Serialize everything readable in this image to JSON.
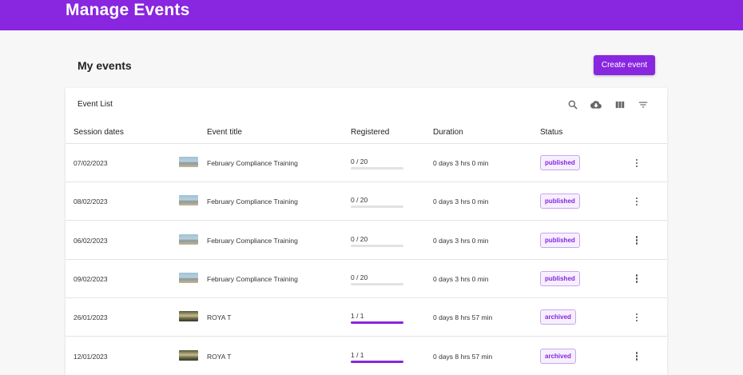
{
  "header": {
    "title": "Manage Events"
  },
  "page": {
    "section_title": "My events",
    "create_label": "Create event"
  },
  "card": {
    "title": "Event List",
    "toolbar": [
      {
        "name": "search-icon"
      },
      {
        "name": "cloud-download-icon"
      },
      {
        "name": "columns-icon"
      },
      {
        "name": "filter-icon"
      }
    ]
  },
  "table": {
    "columns": [
      "Session dates",
      "Event title",
      "Registered",
      "Duration",
      "Status"
    ],
    "rows": [
      {
        "date": "07/02/2023",
        "thumb": "a",
        "title": "February Compliance Training",
        "registered": "0 / 20",
        "progress": 0,
        "duration": "0 days 3 hrs 0 min",
        "status": "published"
      },
      {
        "date": "08/02/2023",
        "thumb": "a",
        "title": "February Compliance Training",
        "registered": "0 / 20",
        "progress": 0,
        "duration": "0 days 3 hrs 0 min",
        "status": "published"
      },
      {
        "date": "06/02/2023",
        "thumb": "a",
        "title": "February Compliance Training",
        "registered": "0 / 20",
        "progress": 0,
        "duration": "0 days 3 hrs 0 min",
        "status": "published"
      },
      {
        "date": "09/02/2023",
        "thumb": "a",
        "title": "February Compliance Training",
        "registered": "0 / 20",
        "progress": 0,
        "duration": "0 days 3 hrs 0 min",
        "status": "published"
      },
      {
        "date": "26/01/2023",
        "thumb": "b",
        "title": "ROYA T",
        "registered": "1 / 1",
        "progress": 1,
        "duration": "0 days 8 hrs 57 min",
        "status": "archived"
      },
      {
        "date": "12/01/2023",
        "thumb": "b",
        "title": "ROYA T",
        "registered": "1 / 1",
        "progress": 1,
        "duration": "0 days 8 hrs 57 min",
        "status": "archived"
      }
    ]
  },
  "colors": {
    "brand": "#8826e0",
    "badge_border": "#c9a7ef",
    "badge_bg": "#f6effd"
  }
}
